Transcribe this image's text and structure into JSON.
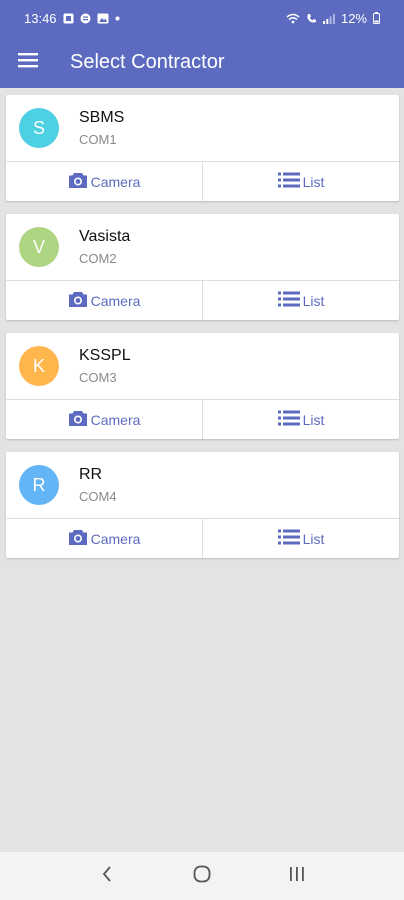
{
  "status": {
    "time": "13:46",
    "battery": "12%"
  },
  "appbar": {
    "title": "Select Contractor"
  },
  "contractors": [
    {
      "initial": "S",
      "name": "SBMS",
      "code": "COM1",
      "color": "#4dd0e1",
      "camera_label": "Camera",
      "list_label": "List"
    },
    {
      "initial": "V",
      "name": "Vasista",
      "code": "COM2",
      "color": "#aed581",
      "camera_label": "Camera",
      "list_label": "List"
    },
    {
      "initial": "K",
      "name": "KSSPL",
      "code": "COM3",
      "color": "#ffb74d",
      "camera_label": "Camera",
      "list_label": "List"
    },
    {
      "initial": "R",
      "name": "RR",
      "code": "COM4",
      "color": "#64b5f6",
      "camera_label": "Camera",
      "list_label": "List"
    }
  ],
  "icons": {
    "menu": "menu-icon",
    "camera": "camera-icon",
    "list": "list-icon",
    "back": "back-icon",
    "home": "home-icon",
    "recents": "recents-icon"
  },
  "colors": {
    "primary": "#5c6bc0",
    "background": "#e3e3e3"
  }
}
